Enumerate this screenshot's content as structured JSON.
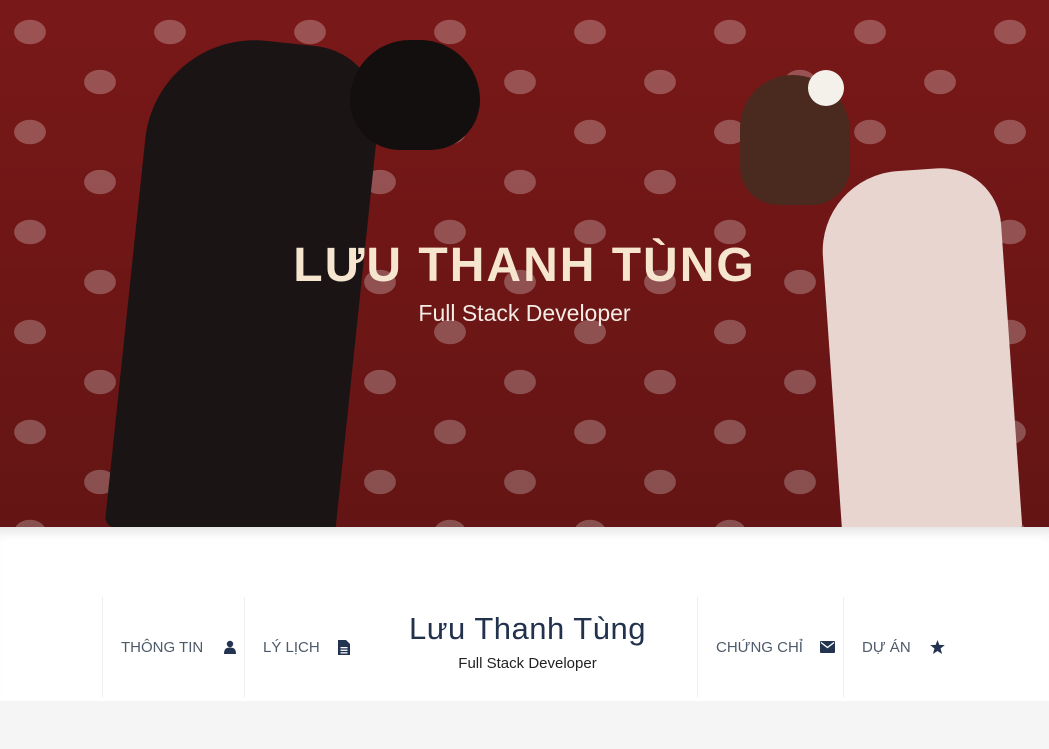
{
  "hero": {
    "title": "LƯU THANH TÙNG",
    "subtitle": "Full Stack Developer"
  },
  "profile": {
    "name": "Lưu Thanh Tùng",
    "role": "Full Stack Developer"
  },
  "nav": {
    "items": [
      {
        "label": "THÔNG TIN",
        "icon": "user-icon"
      },
      {
        "label": "LÝ LỊCH",
        "icon": "file-icon"
      },
      {
        "label": "CHỨNG CHỈ",
        "icon": "envelope-icon"
      },
      {
        "label": "DỰ ÁN",
        "icon": "star-icon"
      }
    ]
  },
  "colors": {
    "hero_title": "#f6e6d0",
    "nav_text": "#4d5a6a",
    "icon": "#22344f",
    "name": "#22324c"
  }
}
